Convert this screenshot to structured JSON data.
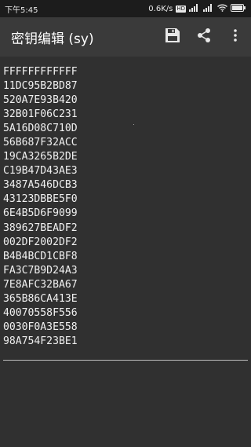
{
  "status_bar": {
    "time": "下午5:45",
    "net_speed": "0.6K/s",
    "badge": "HD",
    "battery_icon": "battery-icon",
    "wifi_icon": "wifi-icon",
    "signal_icon": "signal-icon"
  },
  "appbar": {
    "title": "密钥编辑 (sy)",
    "save_icon": "save-icon",
    "share_icon": "share-icon",
    "more_icon": "more-vert-icon"
  },
  "editor": {
    "lines": [
      "FFFFFFFFFFFF",
      "11DC95B2BD87",
      "520A7E93B420",
      "32B01F06C231",
      "5A16D08C710D",
      "56B687F32ACC",
      "19CA3265B2DE",
      "C19B47D43AE3",
      "3487A546DCB3",
      "43123DBBE5F0",
      "6E4B5D6F9099",
      "389627BEADF2",
      "002DF2002DF2",
      "B4B4BCD1CBF8",
      "FA3C7B9D24A3",
      "7E8AFC32BA67",
      "365B86CA413E",
      "40070558F556",
      "0030F0A3E558",
      "98A754F23BE1"
    ]
  }
}
